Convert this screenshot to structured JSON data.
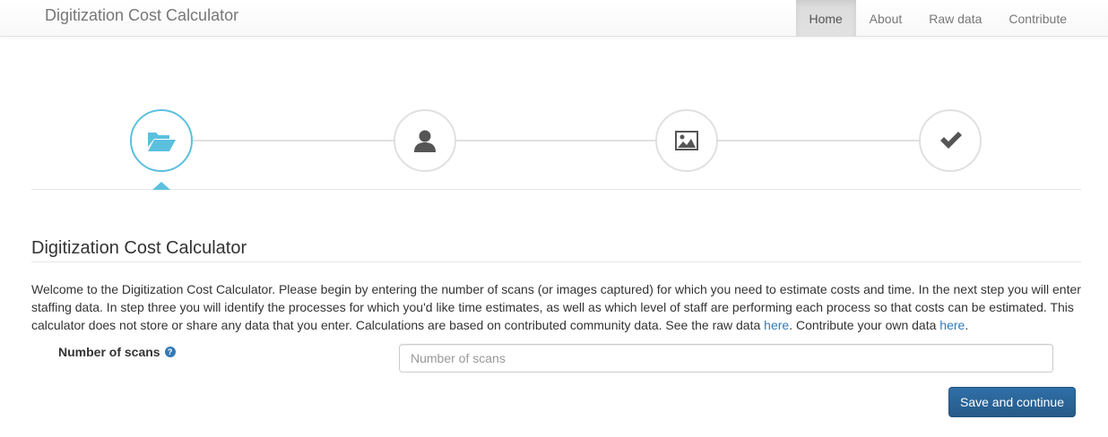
{
  "navbar": {
    "brand": "Digitization Cost Calculator",
    "items": [
      {
        "label": "Home",
        "active": true
      },
      {
        "label": "About",
        "active": false
      },
      {
        "label": "Raw data",
        "active": false
      },
      {
        "label": "Contribute",
        "active": false
      }
    ]
  },
  "wizard": {
    "steps": [
      {
        "icon": "folder-open-icon",
        "active": true
      },
      {
        "icon": "user-icon",
        "active": false
      },
      {
        "icon": "picture-icon",
        "active": false
      },
      {
        "icon": "check-icon",
        "active": false
      }
    ],
    "colors": {
      "active": "#5bc0de",
      "inactive": "#e0e0e0",
      "icon": "#555555"
    }
  },
  "main": {
    "title": "Digitization Cost Calculator",
    "intro": {
      "text_1": "Welcome to the Digitization Cost Calculator. Please begin by entering the number of scans (or images captured) for which you need to estimate costs and time. In the next step you will enter staffing data. In step three you will identify the processes for which you'd like time estimates, as well as which level of staff are performing each process so that costs can be estimated. This calculator does not store or share any data that you enter. Calculations are based on contributed community data. See the raw data ",
      "link_1": "here",
      "text_2": ". Contribute your own data ",
      "link_2": "here",
      "text_3": "."
    },
    "form": {
      "label": "Number of scans",
      "help_icon": "question-circle-icon",
      "input_value": "",
      "input_placeholder": "Number of scans",
      "submit_label": "Save and continue"
    }
  },
  "colors": {
    "link": "#337ab7",
    "primary_button": "#286090",
    "active_step": "#5bc0de"
  }
}
